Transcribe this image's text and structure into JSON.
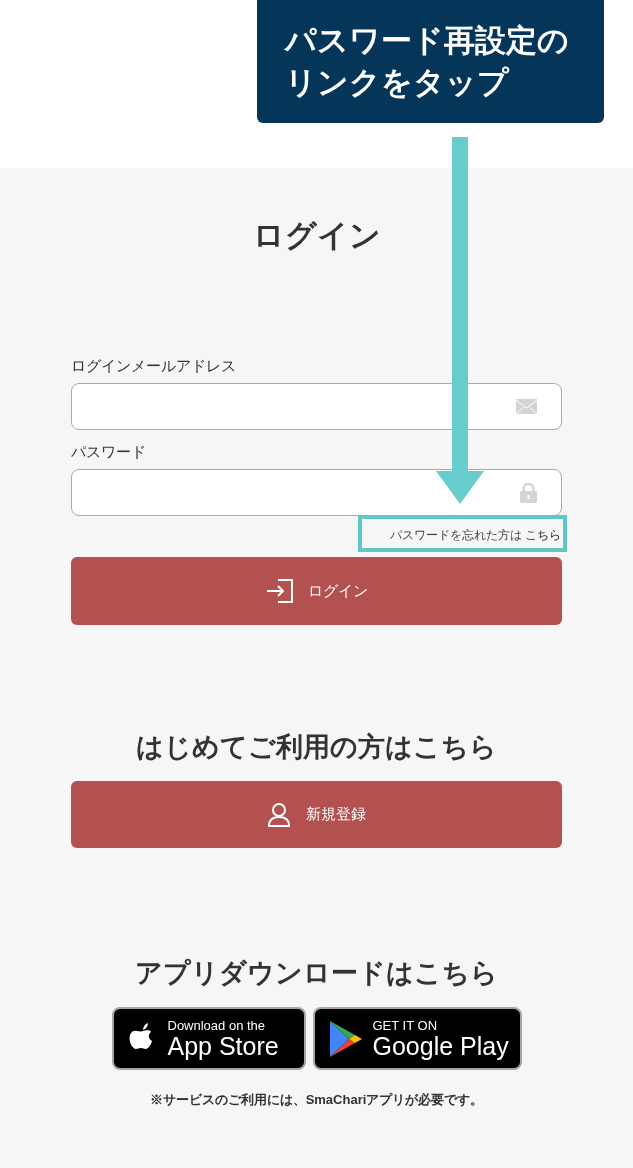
{
  "callout": {
    "lines": [
      "パスワード再設定の",
      "リンクをタップ"
    ]
  },
  "login": {
    "title": "ログイン",
    "fields": [
      {
        "label": "ログインメールアドレス",
        "kind": "email"
      },
      {
        "label": "パスワード",
        "kind": "password"
      }
    ],
    "forgot": {
      "text": "パスワードを忘れた方は",
      "link": "こちら",
      "highlighted": true
    },
    "button": "ログイン"
  },
  "register": {
    "title": "はじめてご利用の方はこちら",
    "button": "新規登録"
  },
  "apps": {
    "title": "アプリダウンロードはこちら",
    "badges": [
      {
        "kind": "apple",
        "small": "Download on the",
        "large": "App Store"
      },
      {
        "kind": "google",
        "small": "GET IT ON",
        "large": "Google Play"
      }
    ],
    "note": "※サービスのご利用には、SmaChariアプリが必要です。"
  }
}
